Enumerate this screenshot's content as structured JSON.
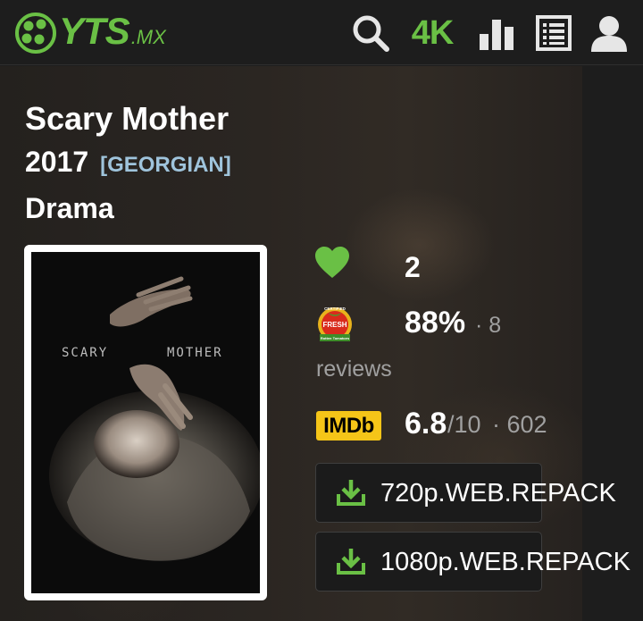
{
  "header": {
    "logo_text": "YTS",
    "logo_tld": ".MX",
    "nav_4k_label": "4K"
  },
  "movie": {
    "title": "Scary Mother",
    "year": "2017",
    "language": "[GEORGIAN]",
    "genre": "Drama"
  },
  "poster": {
    "word_left": "SCARY",
    "word_right": "MOTHER"
  },
  "ratings": {
    "likes": "2",
    "rt_badge_top": "CERTIFIED",
    "rt_badge_fresh": "FRESH",
    "rt_badge_bottom": "Rotten Tomatoes",
    "rt_percent": "88%",
    "rt_count": "· 8",
    "rt_reviews_label": "reviews",
    "imdb_badge": "IMDb",
    "imdb_score": "6.8",
    "imdb_out_of": "/10",
    "imdb_votes": "· 602"
  },
  "downloads": [
    {
      "label": "720p.WEB.REPACK"
    },
    {
      "label": "1080p.WEB.REPACK"
    }
  ],
  "colors": {
    "accent": "#6ac045",
    "imdb_yellow": "#f5c518",
    "language_blue": "#9fc4dc",
    "muted_text": "#a0a0a0"
  },
  "icons": [
    "film-reel-icon",
    "search-icon",
    "stats-icon",
    "list-icon",
    "user-icon",
    "heart-icon",
    "tomato-icon",
    "download-icon"
  ]
}
